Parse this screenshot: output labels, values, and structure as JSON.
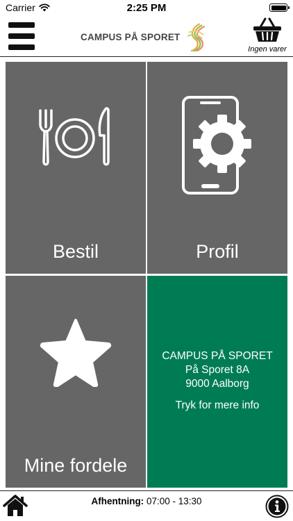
{
  "status_bar": {
    "carrier": "Carrier",
    "time": "2:25 PM",
    "icons": [
      "wifi-icon",
      "battery-icon"
    ]
  },
  "header": {
    "logo_text": "CAMPUS PÅ SPORET",
    "menu_icon": "hamburger-menu-icon",
    "cart_icon": "shopping-basket-icon",
    "cart_label": "Ingen varer"
  },
  "tiles": {
    "bestil": {
      "label": "Bestil",
      "icon": "plate-cutlery-icon"
    },
    "profil": {
      "label": "Profil",
      "icon": "phone-gear-icon"
    },
    "fordele": {
      "label": "Mine fordele",
      "icon": "star-icon"
    },
    "info": {
      "name": "CAMPUS PÅ SPORET",
      "street": "På Sporet 8A",
      "city": "9000 Aalborg",
      "more": "Tryk for mere info"
    }
  },
  "footer": {
    "pickup_label": "Afhentning:",
    "pickup_time": "07:00 - 13:30",
    "home_icon": "home-icon",
    "info_icon": "info-icon"
  },
  "colors": {
    "tile_gray": "#666666",
    "info_green": "#007c55"
  }
}
